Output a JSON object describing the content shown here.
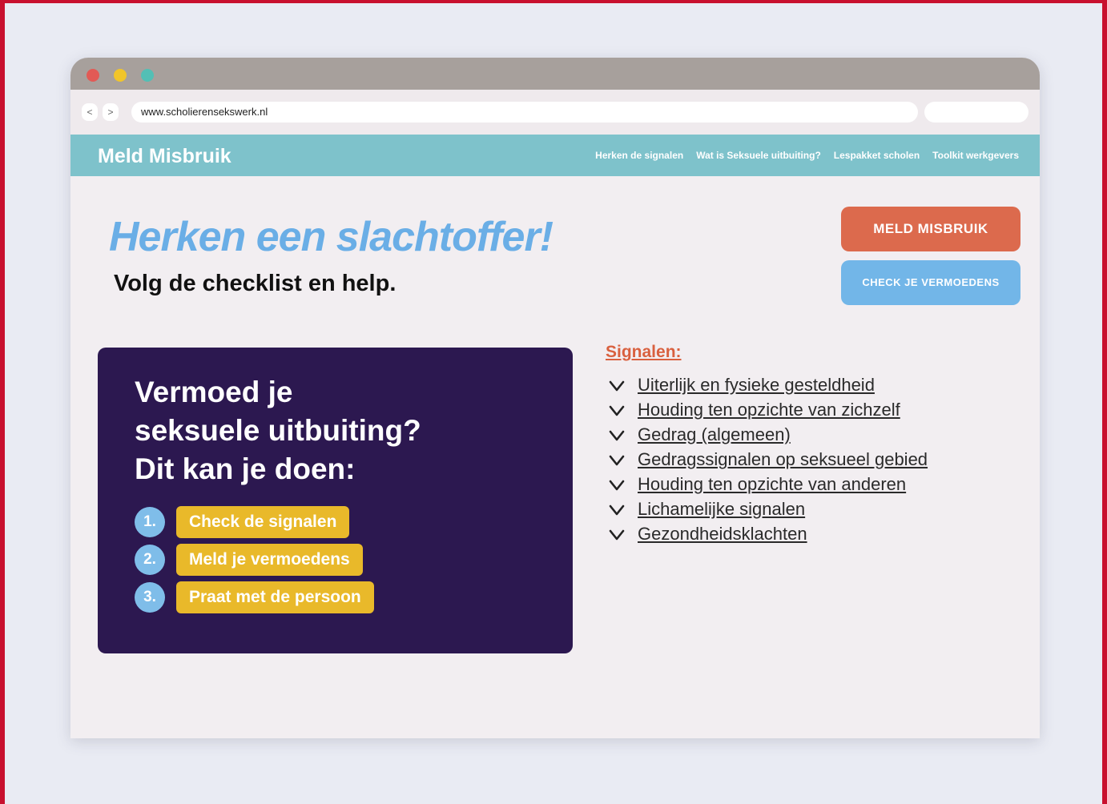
{
  "browser": {
    "back": "<",
    "forward": ">",
    "url": "www.scholierensekswerk.nl"
  },
  "site": {
    "brand": "Meld Misbruik",
    "nav": [
      "Herken de signalen",
      "Wat is Seksuele uitbuiting?",
      "Lespakket scholen",
      "Toolkit werkgevers"
    ]
  },
  "hero": {
    "title": "Herken een slachtoffer!",
    "subtitle": "Volg de checklist en help."
  },
  "actions": {
    "report": "MELD MISBRUIK",
    "check": "CHECK JE VERMOEDENS"
  },
  "card": {
    "heading_lines": [
      "Vermoed je",
      "seksuele uitbuiting?",
      "Dit kan je doen:"
    ],
    "steps": [
      {
        "num": "1.",
        "label": "Check de signalen"
      },
      {
        "num": "2.",
        "label": "Meld je vermoedens"
      },
      {
        "num": "3.",
        "label": "Praat met de persoon"
      }
    ]
  },
  "signals": {
    "heading": "Signalen:",
    "items": [
      "Uiterlijk en fysieke gesteldheid",
      "Houding ten opzichte van zichzelf",
      "Gedrag (algemeen)",
      "Gedragssignalen op seksueel gebied",
      "Houding ten opzichte van anderen",
      "Lichamelijke signalen",
      "Gezondheidsklachten"
    ]
  },
  "icons": {
    "chevron": "chevron-down-icon"
  },
  "colors": {
    "frame": "#c8102e",
    "nav": "#7ec2cb",
    "title": "#6aaee6",
    "report_button": "#dc6a4d",
    "check_button": "#72b6e8",
    "card": "#2c1850",
    "step_label": "#e9b92a",
    "signals_heading": "#d9603f"
  }
}
